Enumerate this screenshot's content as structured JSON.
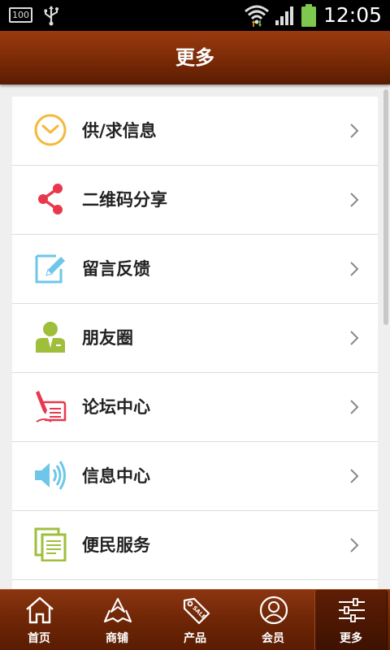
{
  "status_bar": {
    "battery_level_badge": "100",
    "time": "12:05",
    "icons": [
      "usb-icon",
      "wifi-icon",
      "signal-icon",
      "battery-icon"
    ]
  },
  "header": {
    "title": "更多"
  },
  "menu": {
    "items": [
      {
        "label": "供/求信息",
        "icon": "clock-icon",
        "color": "#f5b83c"
      },
      {
        "label": "二维码分享",
        "icon": "share-icon",
        "color": "#e8384d"
      },
      {
        "label": "留言反馈",
        "icon": "edit-note-icon",
        "color": "#6ec6ea"
      },
      {
        "label": "朋友圈",
        "icon": "person-icon",
        "color": "#9fbf3c"
      },
      {
        "label": "论坛中心",
        "icon": "pen-paper-icon",
        "color": "#e8384d"
      },
      {
        "label": "信息中心",
        "icon": "speaker-icon",
        "color": "#6ec6ea"
      },
      {
        "label": "便民服务",
        "icon": "documents-icon",
        "color": "#9fbf3c"
      }
    ]
  },
  "bottom_nav": {
    "items": [
      {
        "label": "首页",
        "icon": "home-icon"
      },
      {
        "label": "商铺",
        "icon": "map-nav-icon"
      },
      {
        "label": "产品",
        "icon": "sale-tag-icon"
      },
      {
        "label": "会员",
        "icon": "member-icon"
      },
      {
        "label": "更多",
        "icon": "sliders-icon",
        "active": true
      }
    ]
  }
}
